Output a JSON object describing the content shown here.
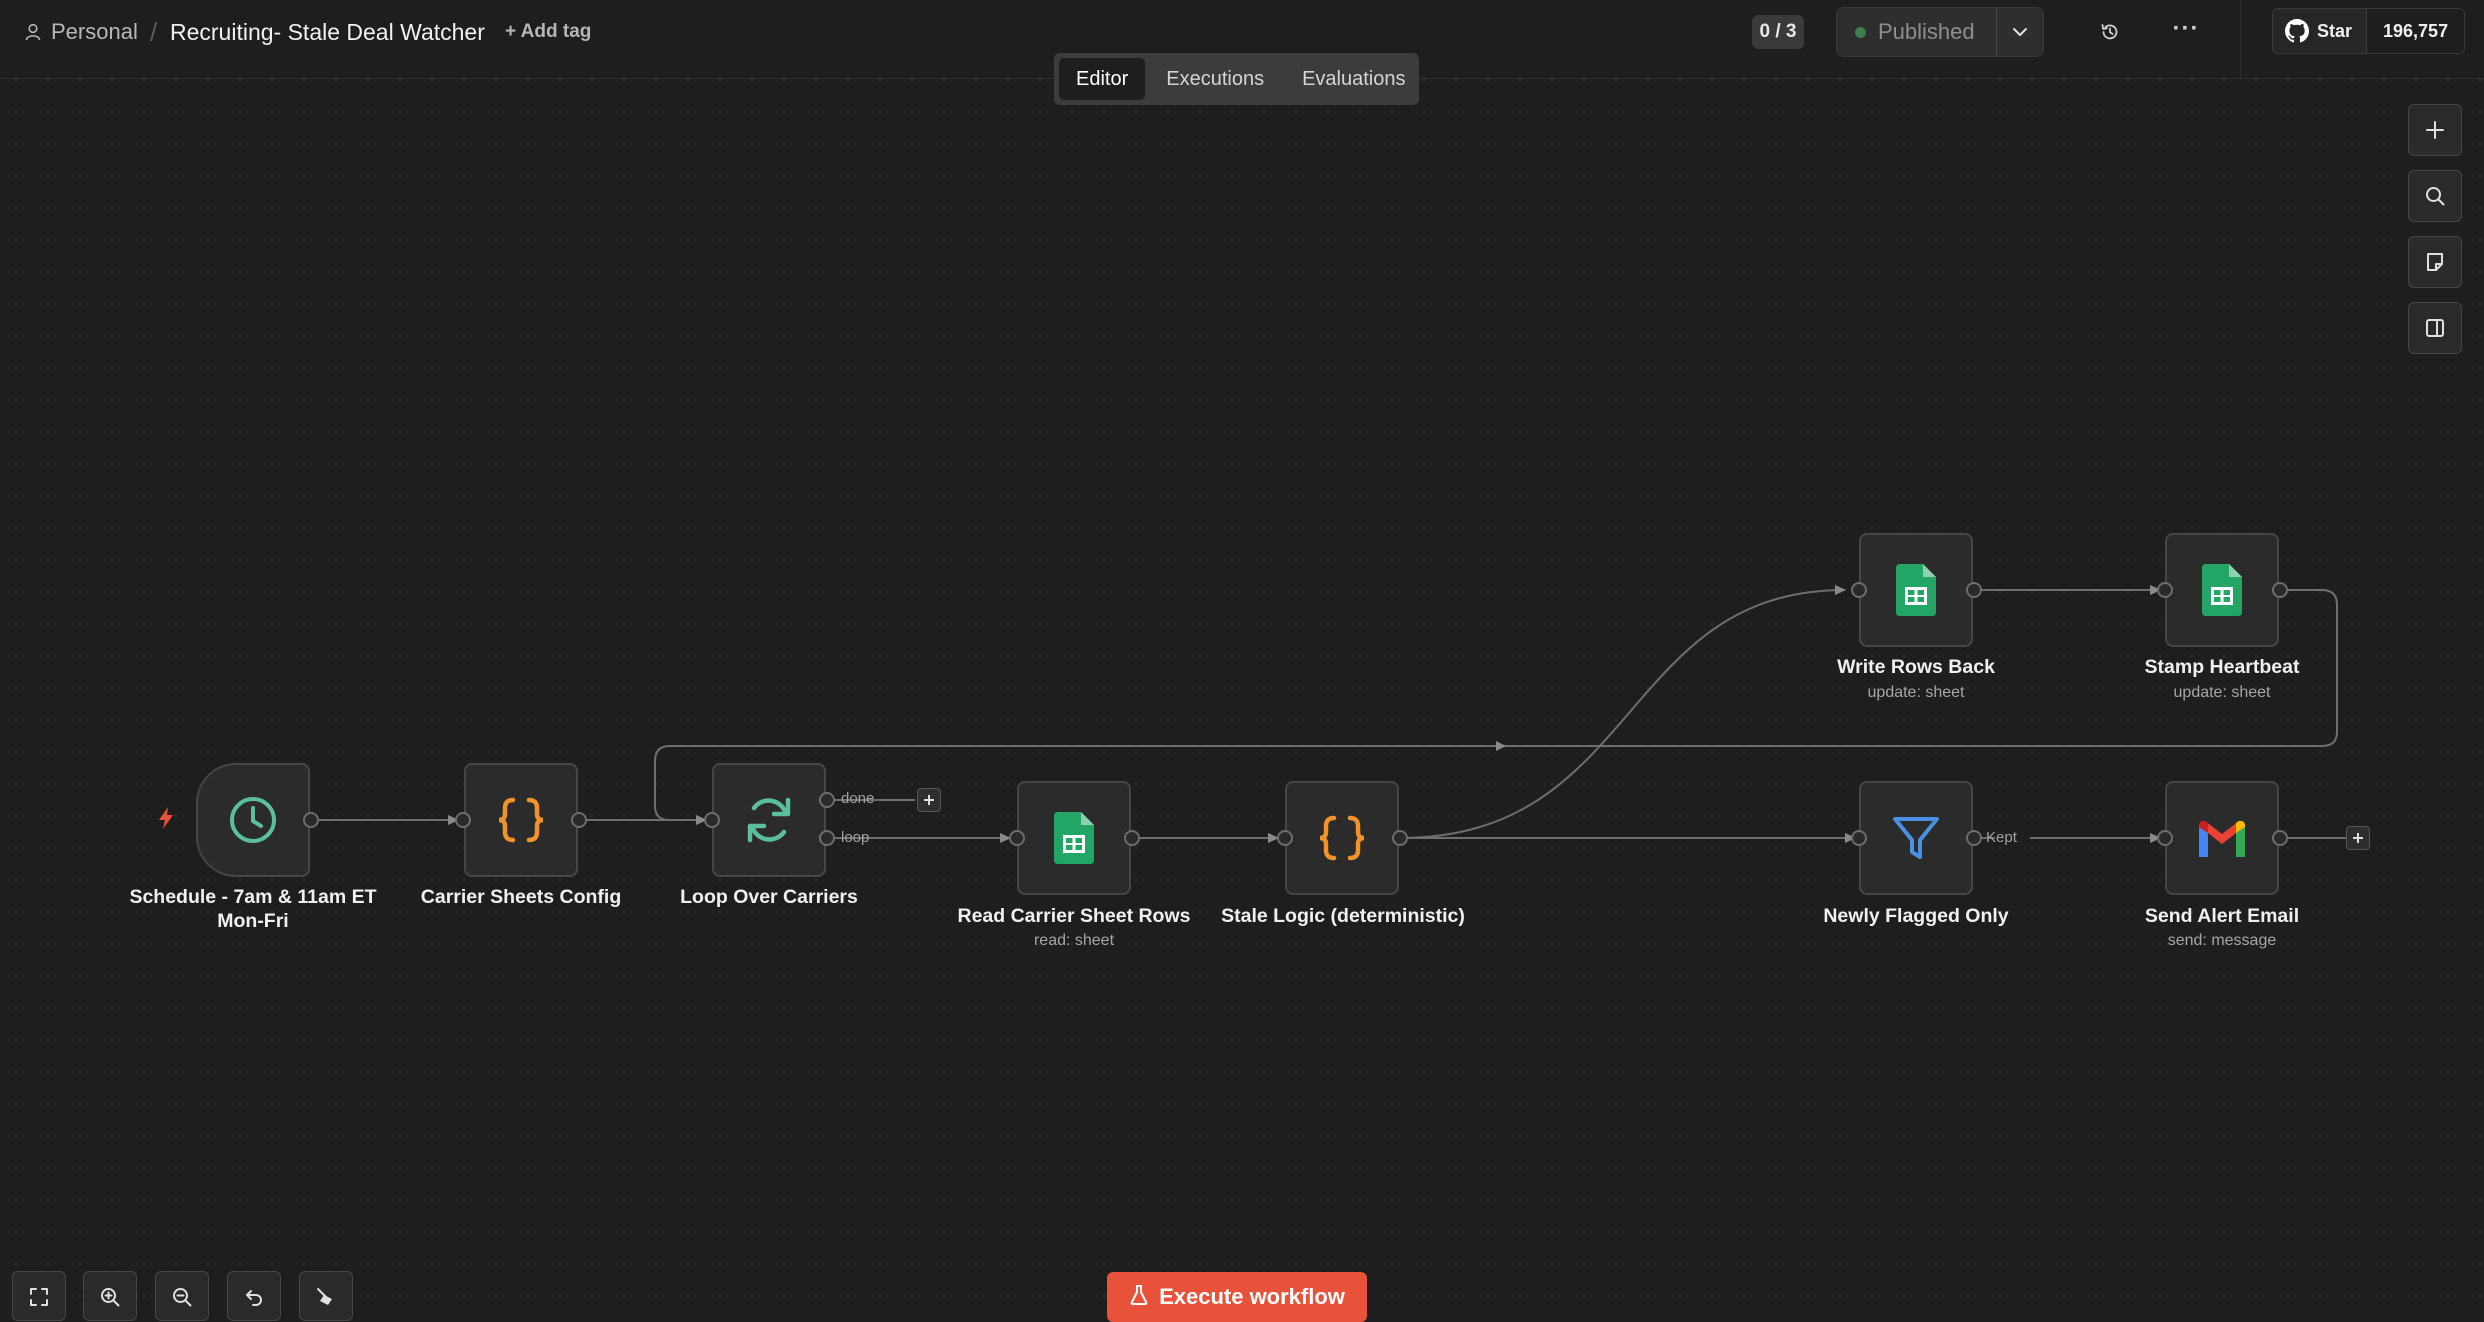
{
  "header": {
    "project": "Personal",
    "separator": "/",
    "workflow_name": "Recruiting- Stale Deal Watcher",
    "add_tag": "+ Add tag",
    "counter": "0 / 3",
    "publish_status": "Published",
    "github_star": "Star",
    "github_count": "196,757"
  },
  "tabs": [
    {
      "label": "Editor",
      "active": true
    },
    {
      "label": "Executions",
      "active": false
    },
    {
      "label": "Evaluations",
      "active": false
    }
  ],
  "nodes": {
    "schedule": {
      "title": "Schedule - 7am & 11am ET Mon-Fri",
      "icon": "clock-icon"
    },
    "config": {
      "title": "Carrier Sheets Config",
      "icon": "code-braces-icon"
    },
    "loop": {
      "title": "Loop Over Carriers",
      "icon": "refresh-icon",
      "output_done": "done",
      "output_loop": "loop"
    },
    "read_rows": {
      "title": "Read Carrier Sheet Rows",
      "subtitle": "read: sheet",
      "icon": "google-sheets-icon"
    },
    "stale_logic": {
      "title": "Stale Logic (deterministic)",
      "icon": "code-braces-icon"
    },
    "write_back": {
      "title": "Write Rows Back",
      "subtitle": "update: sheet",
      "icon": "google-sheets-icon"
    },
    "heartbeat": {
      "title": "Stamp Heartbeat",
      "subtitle": "update: sheet",
      "icon": "google-sheets-icon"
    },
    "filter": {
      "title": "Newly Flagged Only",
      "icon": "filter-icon",
      "output": "Kept"
    },
    "send_email": {
      "title": "Send Alert Email",
      "subtitle": "send: message",
      "icon": "gmail-icon"
    }
  },
  "execute_button": "Execute workflow",
  "colors": {
    "canvas": "#1e1e1e",
    "accent": "#e8523a",
    "sheets_green": "#22a565",
    "code_orange": "#f2922b",
    "teal": "#5bbf9e",
    "filter_blue": "#4a90e2"
  }
}
